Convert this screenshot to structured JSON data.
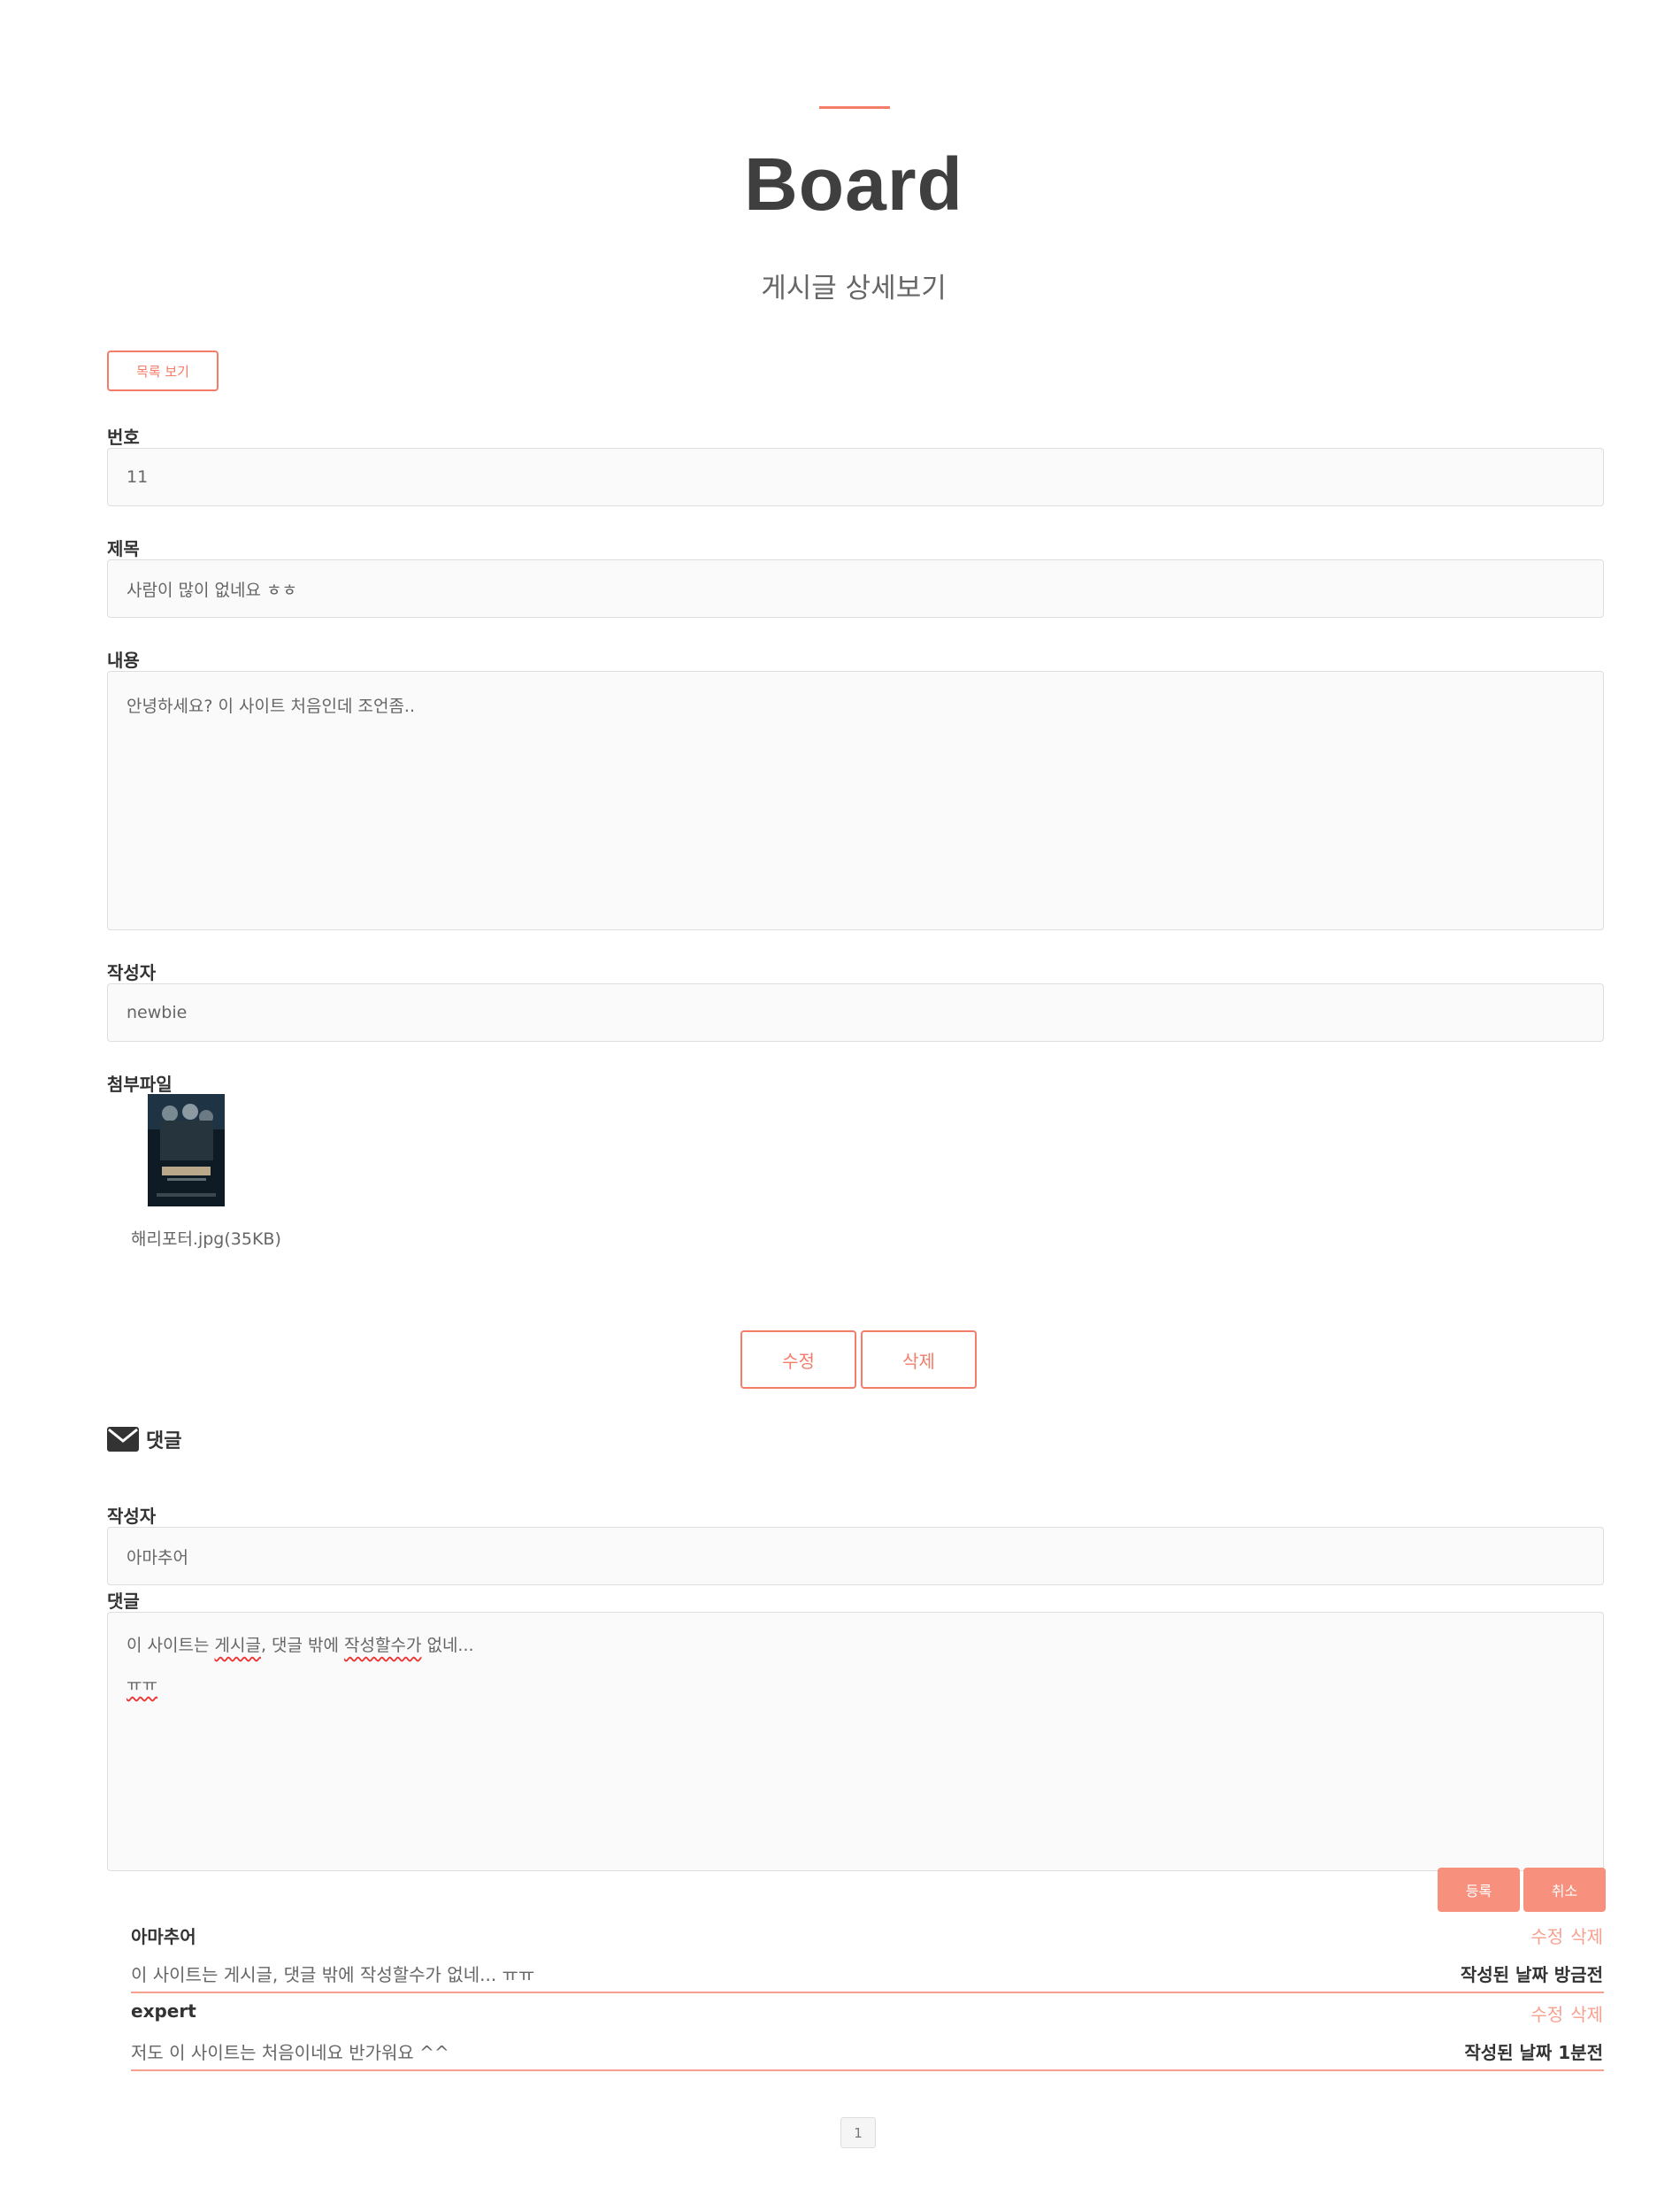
{
  "header": {
    "title": "Board",
    "subtitle": "게시글 상세보기"
  },
  "toolbar": {
    "list_button": "목록 보기"
  },
  "post": {
    "number_label": "번호",
    "number_value": "11",
    "title_label": "제목",
    "title_value": "사람이 많이 없네요 ㅎㅎ",
    "content_label": "내용",
    "content_value": "안녕하세요? 이 사이트 처음인데 조언좀..",
    "author_label": "작성자",
    "author_value": "newbie",
    "attachment_label": "첨부파일",
    "attachment_name": "해리포터.jpg(35KB)"
  },
  "actions": {
    "edit": "수정",
    "delete": "삭제"
  },
  "comment_form": {
    "section_title": "댓글",
    "section_icon": "envelope-icon",
    "author_label": "작성자",
    "author_value": "아마추어",
    "comment_label": "댓글",
    "comment_line1_a": "이 사이트는 ",
    "comment_line1_b": "게시글",
    "comment_line1_c": ", 댓글 밖에 ",
    "comment_line1_d": "작성할수가",
    "comment_line1_e": " 없네...",
    "comment_line2": "ㅠㅠ",
    "submit": "등록",
    "cancel": "취소"
  },
  "comments": [
    {
      "author": "아마추어",
      "edit": "수정",
      "delete": "삭제",
      "text": "이 사이트는 게시글, 댓글 밖에 작성할수가 없네... ㅠㅠ",
      "date": "작성된 날짜 방금전"
    },
    {
      "author": "expert",
      "edit": "수정",
      "delete": "삭제",
      "text": "저도 이 사이트는 처음이네요 반가워요 ^^",
      "date": "작성된 날짜 1분전"
    }
  ],
  "pagination": {
    "current": "1"
  },
  "colors": {
    "accent": "#f47c69",
    "accent_fill": "#f8907e"
  }
}
